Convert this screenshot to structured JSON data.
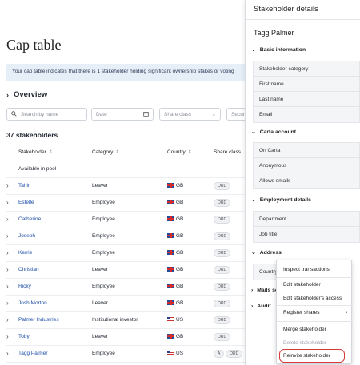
{
  "page": {
    "title": "Cap table",
    "banner": "Your cap table indicates that there is 1 stakeholder holding significant ownership stakes or voting",
    "overview": "Overview",
    "count": "37 stakeholders"
  },
  "filters": {
    "search_placeholder": "Search by name",
    "date_placeholder": "Date",
    "share_class": "Share class",
    "security": "Secur"
  },
  "table": {
    "headers": [
      "Stakeholder",
      "Category",
      "Country",
      "Share class"
    ],
    "pool": {
      "name": "Available in pool",
      "category": "-",
      "country": "-",
      "share": "-"
    },
    "rows": [
      {
        "name": "Tahir",
        "category": "Leaver",
        "country": "GB",
        "flag": "gb",
        "share": "ORD"
      },
      {
        "name": "Estelle",
        "category": "Employee",
        "country": "GB",
        "flag": "gb",
        "share": "ORD"
      },
      {
        "name": "Catherine",
        "category": "Employee",
        "country": "GB",
        "flag": "gb",
        "share": "ORD"
      },
      {
        "name": "Joseph",
        "category": "Employee",
        "country": "GB",
        "flag": "gb",
        "share": "ORD"
      },
      {
        "name": "Kerrie",
        "category": "Employee",
        "country": "GB",
        "flag": "gb",
        "share": "ORD"
      },
      {
        "name": "Christian",
        "category": "Leaver",
        "country": "GB",
        "flag": "gb",
        "share": "ORD"
      },
      {
        "name": "Ricky",
        "category": "Employee",
        "country": "GB",
        "flag": "gb",
        "share": "ORD"
      },
      {
        "name": "Josh Morton",
        "category": "Leaver",
        "country": "GB",
        "flag": "gb",
        "share": "ORD"
      },
      {
        "name": "Palmer Industries",
        "category": "Institutional investor",
        "country": "US",
        "flag": "us",
        "share": "ORD"
      },
      {
        "name": "Toby",
        "category": "Leaver",
        "country": "GB",
        "flag": "gb",
        "share": "ORD"
      },
      {
        "name": "Tagg Palmer",
        "category": "Employee",
        "country": "US",
        "flag": "us",
        "share": "ORD",
        "extra_pill": "A"
      }
    ]
  },
  "panel": {
    "title": "Stakeholder details",
    "person": "Tagg Palmer",
    "basic": {
      "title": "Basic information",
      "rows": [
        "Stakeholder category",
        "First name",
        "Last name",
        "Email"
      ]
    },
    "carta": {
      "title": "Carta account",
      "rows": [
        "On Carta",
        "Anonymous",
        "Allows emails"
      ]
    },
    "employment": {
      "title": "Employment details",
      "rows": [
        "Department",
        "Job title"
      ]
    },
    "address": {
      "title": "Address",
      "rows": [
        "Country"
      ]
    },
    "mails": {
      "title": "Mails se"
    },
    "audit": {
      "title": "Audit"
    }
  },
  "menu": {
    "items": [
      "Inspect transactions",
      "Edit stakeholder",
      "Edit stakeholder's access",
      "Register shares",
      "Merge stakeholder",
      "Delete stakeholder",
      "Reinvite stakeholder"
    ]
  },
  "colors": {
    "accent": "#1f4fa8",
    "highlight": "#d63a3a"
  }
}
